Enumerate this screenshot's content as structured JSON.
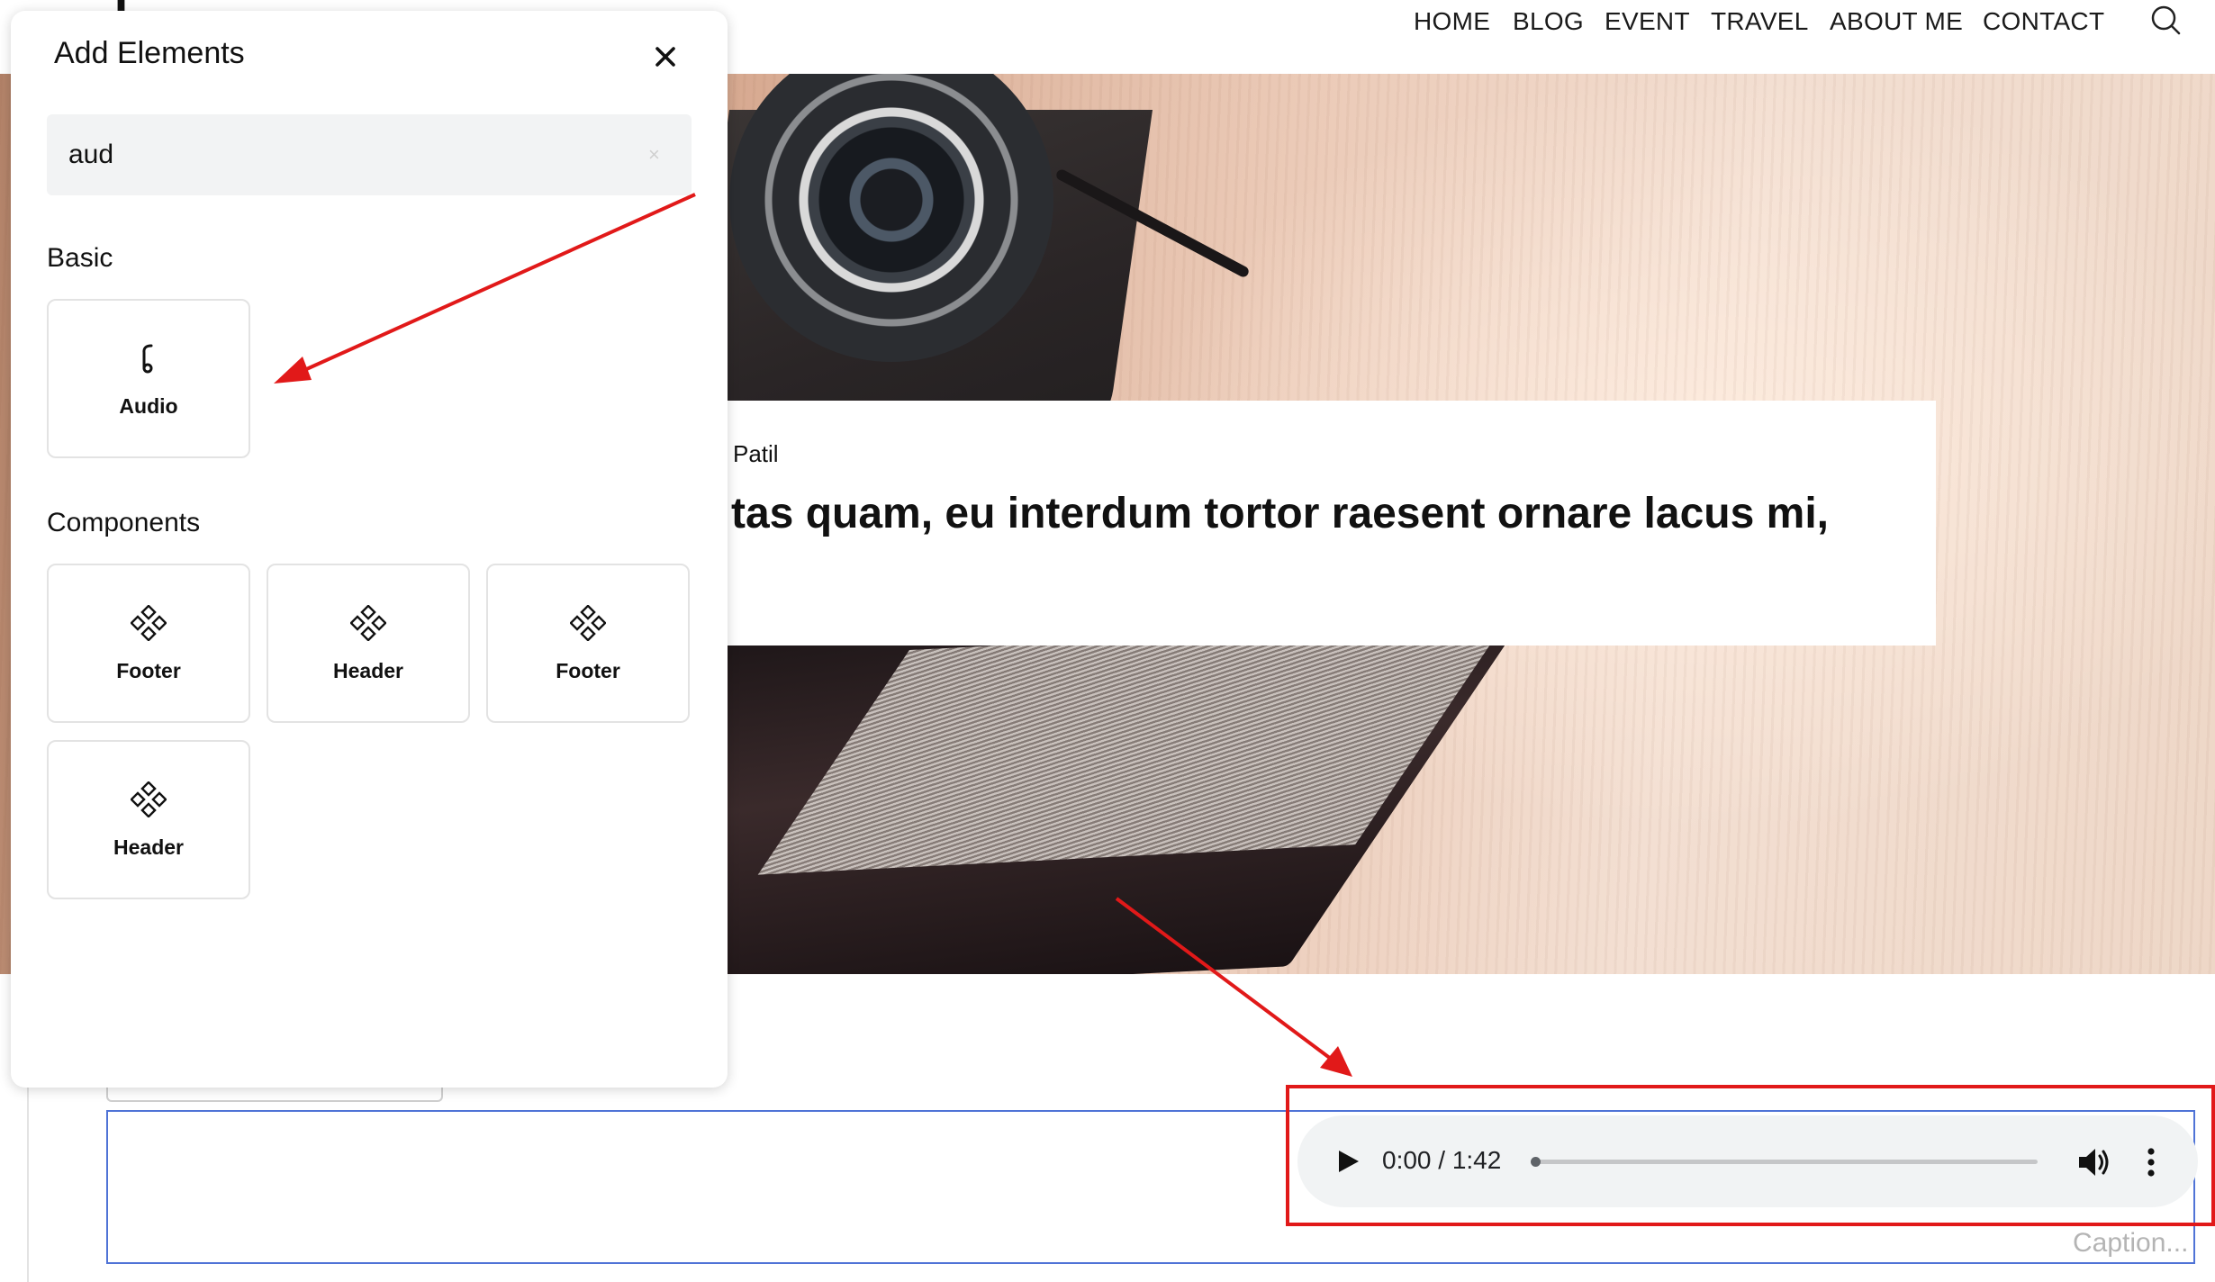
{
  "site": {
    "logo": "T",
    "nav": [
      "HOME",
      "BLOG",
      "EVENT",
      "TRAVEL",
      "ABOUT ME",
      "CONTACT"
    ],
    "search_icon": "search-icon"
  },
  "post": {
    "author": "Patil",
    "title": "tas quam, eu interdum tortor raesent ornare lacus mi,"
  },
  "panel": {
    "title": "Add Elements",
    "search_value": "aud",
    "basic_label": "Basic",
    "components_label": "Components",
    "basic_items": [
      {
        "label": "Audio",
        "icon": "music-note-icon"
      }
    ],
    "component_items": [
      {
        "label": "Footer",
        "icon": "component-icon"
      },
      {
        "label": "Header",
        "icon": "component-icon"
      },
      {
        "label": "Footer",
        "icon": "component-icon"
      },
      {
        "label": "Header",
        "icon": "component-icon"
      }
    ]
  },
  "audio": {
    "time": "0:00 / 1:42",
    "progress": 0,
    "caption_placeholder": "Caption..."
  },
  "colors": {
    "annotation": "#e11919",
    "selection_border": "#4f73d6",
    "player_bg": "#f1f3f4"
  }
}
